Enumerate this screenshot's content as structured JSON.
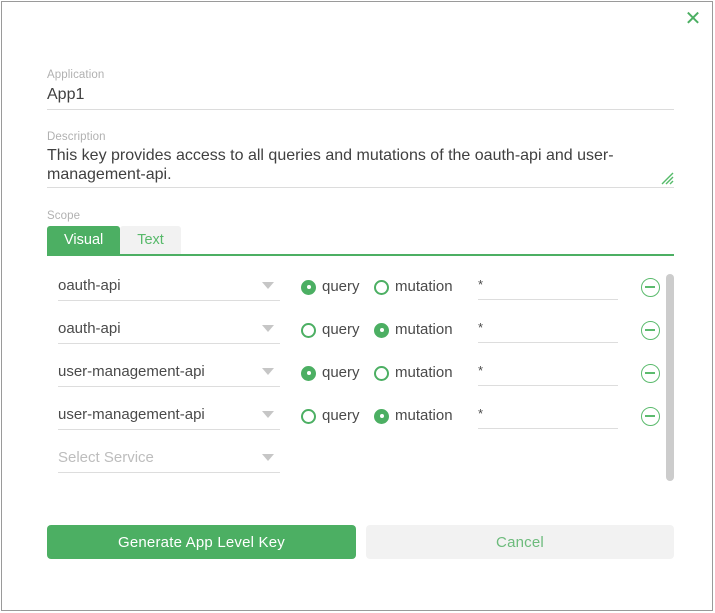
{
  "dialog": {
    "close_label": "✕",
    "accent_color": "#4caf63",
    "border_color": "#9a9a9a"
  },
  "application": {
    "label": "Application",
    "value": "App1"
  },
  "description": {
    "label": "Description",
    "value": "This key provides access to all queries and mutations of the oauth-api and user-management-api."
  },
  "scope": {
    "label": "Scope",
    "tabs": [
      {
        "label": "Visual",
        "active": true
      },
      {
        "label": "Text",
        "active": false
      }
    ],
    "radio_labels": {
      "query": "query",
      "mutation": "mutation"
    },
    "service_placeholder": "Select Service",
    "rows": [
      {
        "service": "oauth-api",
        "operation": "query",
        "pattern": "*",
        "is_placeholder": false
      },
      {
        "service": "oauth-api",
        "operation": "mutation",
        "pattern": "*",
        "is_placeholder": false
      },
      {
        "service": "user-management-api",
        "operation": "query",
        "pattern": "*",
        "is_placeholder": false
      },
      {
        "service": "user-management-api",
        "operation": "mutation",
        "pattern": "*",
        "is_placeholder": false
      },
      {
        "service": "Select Service",
        "operation": null,
        "pattern": "",
        "is_placeholder": true
      }
    ]
  },
  "footer": {
    "primary_label": "Generate App Level Key",
    "secondary_label": "Cancel"
  }
}
